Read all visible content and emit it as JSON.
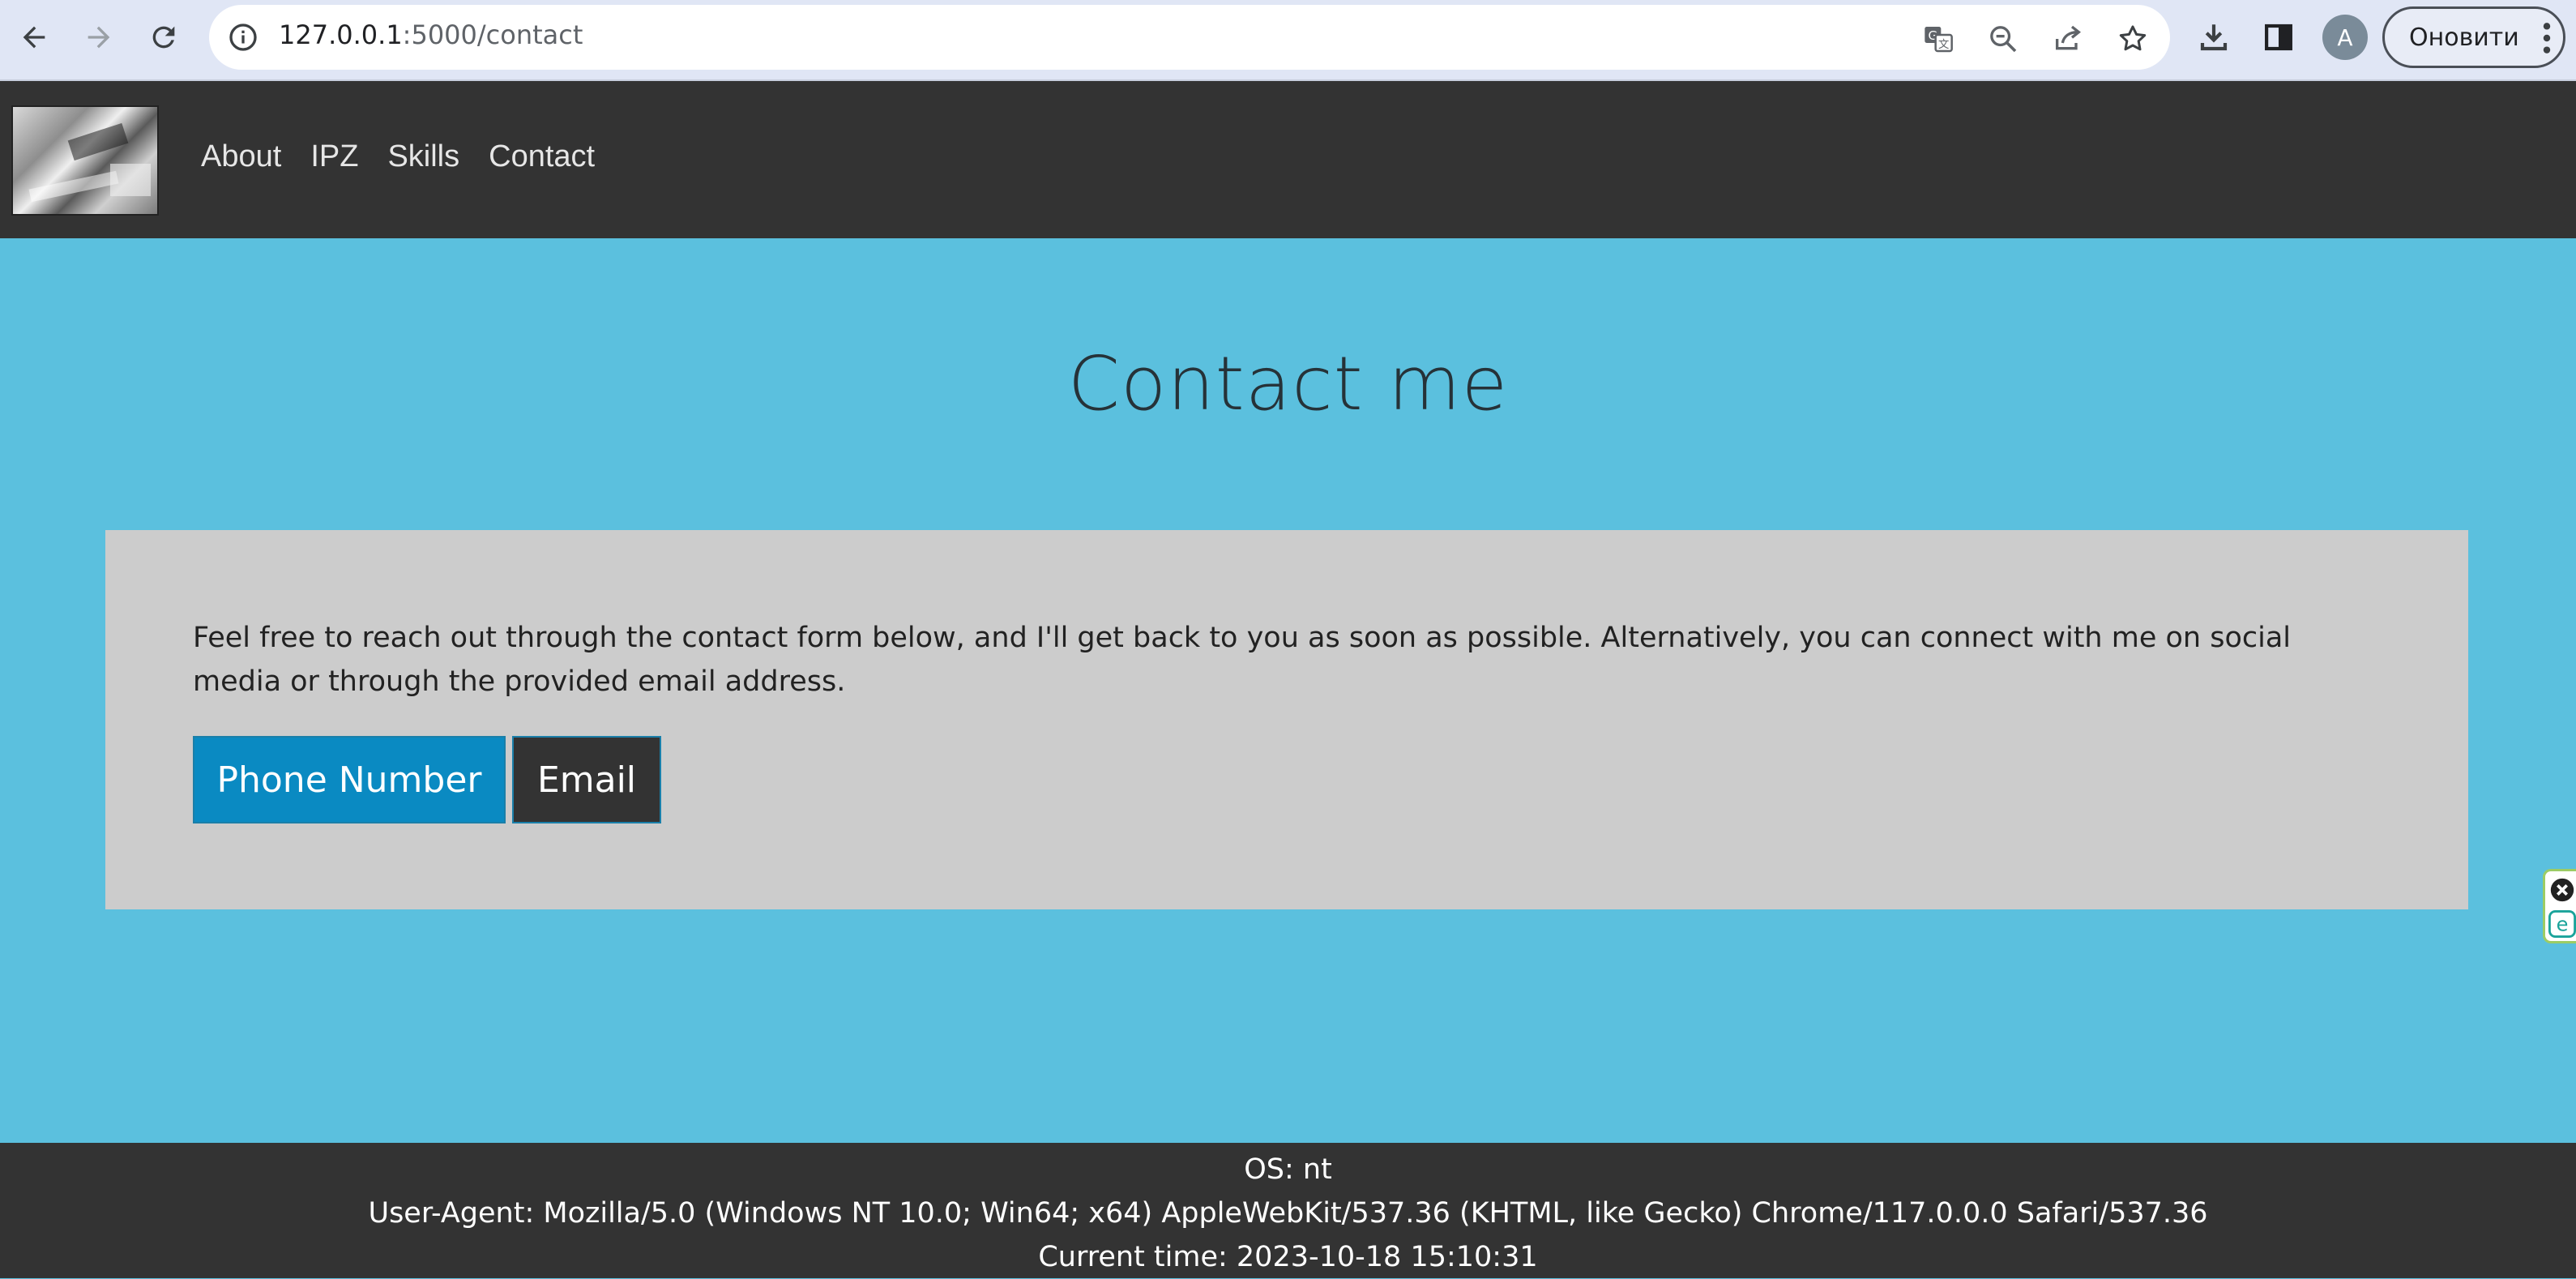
{
  "browser": {
    "url_host": "127.0.0.1",
    "url_path": ":5000/contact",
    "avatar_letter": "A",
    "update_label": "Оновити"
  },
  "header": {
    "nav": [
      "About",
      "IPZ",
      "Skills",
      "Contact"
    ]
  },
  "main": {
    "title": "Contact me",
    "intro": "Feel free to reach out through the contact form below, and I'll get back to you as soon as possible. Alternatively, you can connect with me on social media or through the provided email address.",
    "phone_button": "Phone Number",
    "email_button": "Email"
  },
  "footer": {
    "os": "OS: nt",
    "user_agent": "User-Agent: Mozilla/5.0 (Windows NT 10.0; Win64; x64) AppleWebKit/537.36 (KHTML, like Gecko) Chrome/117.0.0.0 Safari/537.36",
    "time": "Current time: 2023-10-18 15:10:31"
  },
  "colors": {
    "page_bg": "#5bc0de",
    "header_bg": "#333333",
    "card_bg": "#cccccc",
    "phone_btn": "#0a8ac2",
    "email_btn": "#333333"
  }
}
